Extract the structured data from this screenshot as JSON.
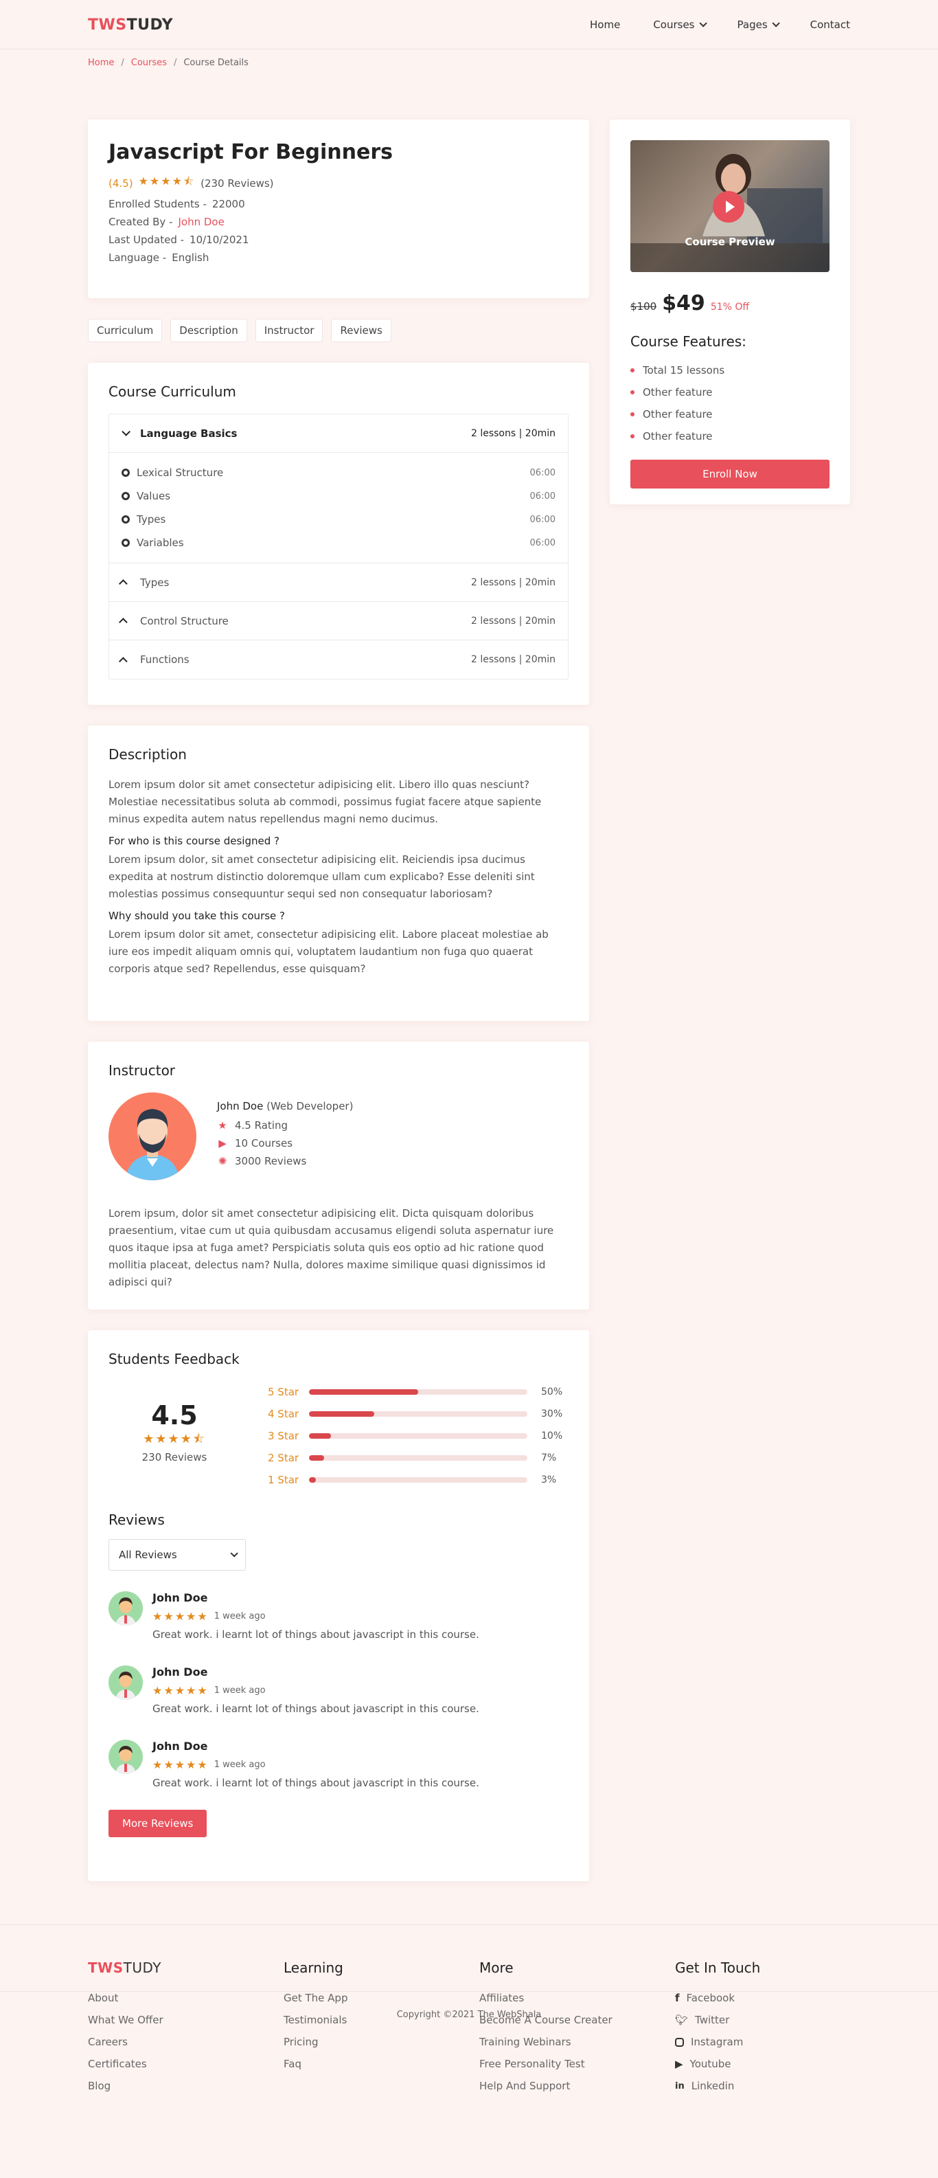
{
  "header": {
    "logo_a": "TWS",
    "logo_b": "TUDY",
    "nav": [
      {
        "label": "Home",
        "dropdown": false
      },
      {
        "label": "Courses",
        "dropdown": true
      },
      {
        "label": "Pages",
        "dropdown": true
      },
      {
        "label": "Contact",
        "dropdown": false
      }
    ]
  },
  "breadcrumb": {
    "home": "Home",
    "courses": "Courses",
    "current": "Course Details",
    "sep": "/"
  },
  "course": {
    "title": "Javascript For Beginners",
    "rating": "(4.5)",
    "reviews_count": "(230 Reviews)",
    "enrolled_label": "Enrolled Students -",
    "enrolled": "22000",
    "created_label": "Created By -",
    "creator": "John Doe",
    "updated_label": "Last Updated -",
    "updated": "10/10/2021",
    "language_label": "Language -",
    "language": "English"
  },
  "tabs": [
    "Curriculum",
    "Description",
    "Instructor",
    "Reviews"
  ],
  "curriculum": {
    "title": "Course Curriculum",
    "open_section": {
      "name": "Language Basics",
      "meta": "2 lessons | 20min",
      "lessons": [
        {
          "name": "Lexical Structure",
          "time": "06:00"
        },
        {
          "name": "Values",
          "time": "06:00"
        },
        {
          "name": "Types",
          "time": "06:00"
        },
        {
          "name": "Variables",
          "time": "06:00"
        }
      ]
    },
    "sections": [
      {
        "name": "Types",
        "meta": "2 lessons | 20min"
      },
      {
        "name": "Control Structure",
        "meta": "2 lessons | 20min"
      },
      {
        "name": "Functions",
        "meta": "2 lessons | 20min"
      }
    ]
  },
  "description": {
    "title": "Description",
    "p1": "Lorem ipsum dolor sit amet consectetur adipisicing elit. Libero illo quas nesciunt? Molestiae necessitatibus soluta ab commodi, possimus fugiat facere atque sapiente minus expedita autem natus repellendus magni nemo ducimus.",
    "h1": "For who is this course designed ?",
    "p2": "Lorem ipsum dolor, sit amet consectetur adipisicing elit. Reiciendis ipsa ducimus expedita at nostrum distinctio doloremque ullam cum explicabo? Esse deleniti sint molestias possimus consequuntur sequi sed non consequatur laboriosam?",
    "h2": "Why should you take this course ?",
    "p3": "Lorem ipsum dolor sit amet, consectetur adipisicing elit. Labore placeat molestiae ab iure eos impedit aliquam omnis qui, voluptatem laudantium non fuga quo quaerat corporis atque sed? Repellendus, esse quisquam?"
  },
  "instructor": {
    "title": "Instructor",
    "name": "John Doe",
    "role": "(Web Developer)",
    "rating": "4.5 Rating",
    "courses": "10 Courses",
    "reviews": "3000 Reviews",
    "bio": "Lorem ipsum, dolor sit amet consectetur adipisicing elit. Dicta quisquam doloribus praesentium, vitae cum ut quia quibusdam accusamus eligendi soluta aspernatur iure quos itaque ipsa at fuga amet? Perspiciatis soluta quis eos optio ad hic ratione quod mollitia placeat, delectus nam? Nulla, dolores maxime similique quasi dignissimos id adipisci qui?"
  },
  "feedback": {
    "title": "Students Feedback",
    "score": "4.5",
    "count": "230 Reviews",
    "bars": [
      {
        "label": "5 Star",
        "pct": "50%",
        "value": 0.5
      },
      {
        "label": "4 Star",
        "pct": "30%",
        "value": 0.3
      },
      {
        "label": "3 Star",
        "pct": "10%",
        "value": 0.1
      },
      {
        "label": "2 Star",
        "pct": "7%",
        "value": 0.07
      },
      {
        "label": "1 Star",
        "pct": "3%",
        "value": 0.03
      }
    ]
  },
  "reviews": {
    "title": "Reviews",
    "filter": "All Reviews",
    "items": [
      {
        "name": "John Doe",
        "time": "1 week ago",
        "text": "Great work. i learnt lot of things about javascript in this course."
      },
      {
        "name": "John Doe",
        "time": "1 week ago",
        "text": "Great work. i learnt lot of things about javascript in this course."
      },
      {
        "name": "John Doe",
        "time": "1 week ago",
        "text": "Great work. i learnt lot of things about javascript in this course."
      }
    ],
    "more": "More Reviews"
  },
  "sidebar": {
    "preview_caption": "Course Preview",
    "old_price": "$100",
    "price": "$49",
    "off": "51% Off",
    "features_title": "Course Features:",
    "features": [
      "Total 15 lessons",
      "Other feature",
      "Other feature",
      "Other feature"
    ],
    "enroll": "Enroll Now"
  },
  "footer": {
    "brand_a": "TWS",
    "brand_b": "TUDY",
    "brand_links": [
      "About",
      "What We Offer",
      "Careers",
      "Certificates",
      "Blog"
    ],
    "learning_title": "Learning",
    "learning_links": [
      "Get The App",
      "Testimonials",
      "Pricing",
      "Faq"
    ],
    "more_title": "More",
    "more_links": [
      "Affiliates",
      "Become A Course Creater",
      "Training Webinars",
      "Free Personality Test",
      "Help And Support"
    ],
    "touch_title": "Get In Touch",
    "touch_links": [
      {
        "label": "Facebook",
        "icon": "facebook-icon"
      },
      {
        "label": "Twitter",
        "icon": "twitter-icon"
      },
      {
        "label": "Instagram",
        "icon": "instagram-icon"
      },
      {
        "label": "Youtube",
        "icon": "youtube-icon"
      },
      {
        "label": "Linkedin",
        "icon": "linkedin-icon"
      }
    ],
    "copyright": "Copyright ©2021 The WebShala"
  },
  "colors": {
    "accent": "#e8505b",
    "star": "#e38a1e",
    "background": "#fdf3f1"
  }
}
